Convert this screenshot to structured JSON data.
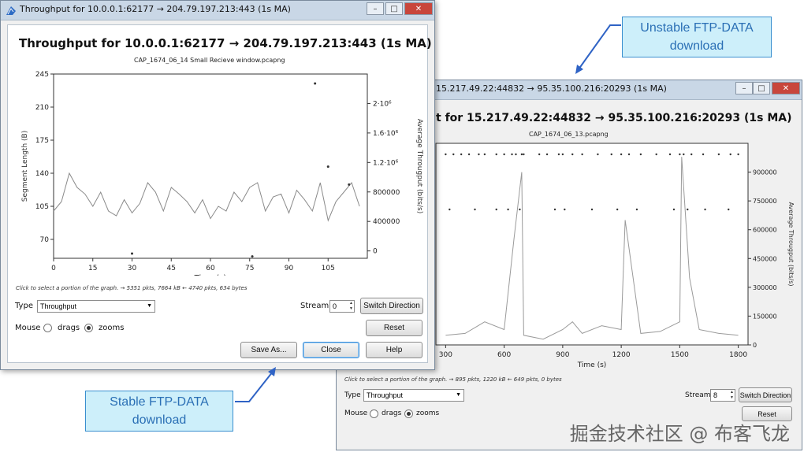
{
  "window1": {
    "title": "Throughput for 10.0.0.1:62177 → 204.79.197.213:443 (1s MA)",
    "heading": "Throughput for 10.0.0.1:62177 → 204.79.197.213:443 (1s MA)",
    "capture": "CAP_1674_06_14 Small Recieve window.pcapng",
    "hint": "Click to select a portion of the graph. → 5351 pkts, 7664 kB ← 4740 pkts, 634 bytes",
    "type_label": "Type",
    "type_value": "Throughput",
    "stream_label": "Stream",
    "stream_value": "0",
    "switch_direction": "Switch Direction",
    "mouse_label": "Mouse",
    "drags_label": "drags",
    "zooms_label": "zooms",
    "reset": "Reset",
    "save_as": "Save As...",
    "close": "Close",
    "help": "Help"
  },
  "window2": {
    "title": "15.217.49.22:44832 → 95.35.100.216:20293 (1s MA)",
    "heading": "t for 15.217.49.22:44832 → 95.35.100.216:20293 (1s MA)",
    "capture": "CAP_1674_06_13.pcapng",
    "hint": "Click to select a portion of the graph. → 895 pkts, 1220 kB ← 649 pkts, 0 bytes",
    "type_label": "Type",
    "type_value": "Throughput",
    "stream_label": "Stream",
    "stream_value": "8",
    "switch_direction": "Switch Direction",
    "mouse_label": "Mouse",
    "drags_label": "drags",
    "zooms_label": "zooms",
    "reset": "Reset"
  },
  "callouts": {
    "unstable_line1": "Unstable FTP-DATA",
    "unstable_line2": "download",
    "stable_line1": "Stable FTP-DATA",
    "stable_line2": "download"
  },
  "watermark": "掘金技术社区 @ 布客飞龙",
  "chart_data": [
    {
      "type": "line",
      "title": "Throughput for 10.0.0.1:62177 → 204.79.197.213:443 (1s MA)",
      "subtitle": "CAP_1674_06_14 Small Recieve window.pcapng",
      "xlabel": "Time (s)",
      "ylabel": "Segment Length (B)",
      "y2label": "Average Througput (bits/s)",
      "xlim": [
        0,
        120
      ],
      "ylim": [
        50,
        245
      ],
      "y2lim": [
        -100000,
        2400000
      ],
      "x_ticks": [
        "0",
        "15",
        "30",
        "45",
        "60",
        "75",
        "90",
        "105"
      ],
      "y_ticks": [
        "70",
        "105",
        "140",
        "175",
        "210",
        "245"
      ],
      "y2_ticks": [
        "0",
        "400000",
        "800000",
        "1.2·10⁶",
        "1.6·10⁶",
        "2·10⁶"
      ],
      "series": [
        {
          "x": [
            0,
            3,
            6,
            9,
            12,
            15,
            18,
            21,
            24,
            27,
            30,
            33,
            36,
            39,
            42,
            45,
            48,
            51,
            54,
            57,
            60,
            63,
            66,
            69,
            72,
            75,
            78,
            81,
            84,
            87,
            90,
            93,
            96,
            99,
            102,
            105,
            108,
            111,
            114,
            117
          ],
          "y": [
            100,
            110,
            140,
            125,
            118,
            105,
            120,
            100,
            95,
            112,
            98,
            108,
            130,
            120,
            100,
            125,
            118,
            110,
            98,
            112,
            92,
            105,
            100,
            120,
            110,
            125,
            130,
            100,
            115,
            118,
            98,
            122,
            112,
            100,
            130,
            90,
            110,
            120,
            130,
            105
          ]
        },
        {
          "name": "outliers",
          "x": [
            30,
            76,
            100,
            105,
            113
          ],
          "y": [
            55,
            52,
            235,
            147,
            128
          ]
        }
      ]
    },
    {
      "type": "line",
      "subtitle": "CAP_1674_06_13.pcapng",
      "xlabel": "Time (s)",
      "y2label": "Average Througput (bits/s)",
      "xlim": [
        250,
        1850
      ],
      "y2lim": [
        0,
        1050000
      ],
      "x_ticks": [
        "300",
        "600",
        "900",
        "1200",
        "1500",
        "1800"
      ],
      "y2_ticks": [
        "0",
        "150000",
        "300000",
        "450000",
        "600000",
        "750000",
        "900000"
      ],
      "series": [
        {
          "x": [
            300,
            400,
            500,
            600,
            650,
            690,
            700,
            800,
            900,
            950,
            1000,
            1100,
            1200,
            1220,
            1300,
            1400,
            1500,
            1510,
            1550,
            1600,
            1700,
            1800
          ],
          "y": [
            50000,
            60000,
            120000,
            80000,
            550000,
            900000,
            50000,
            30000,
            80000,
            120000,
            60000,
            100000,
            80000,
            650000,
            60000,
            70000,
            120000,
            980000,
            350000,
            80000,
            60000,
            50000
          ]
        }
      ]
    }
  ]
}
